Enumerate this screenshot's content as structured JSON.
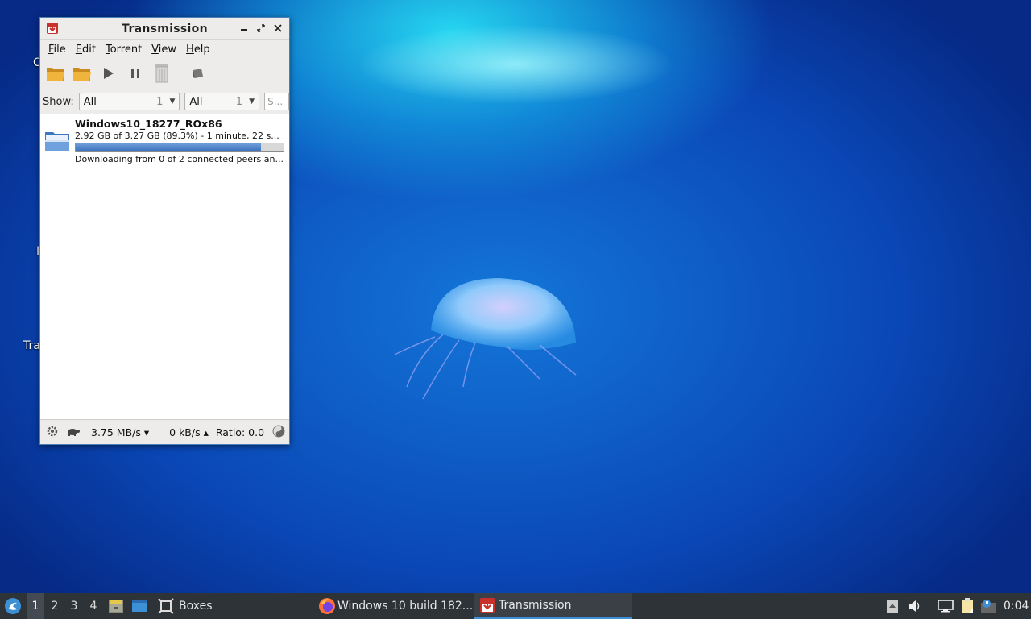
{
  "desktop": {
    "fragment_1": "C",
    "fragment_2": "I",
    "fragment_3": "Tra"
  },
  "window": {
    "title": "Transmission",
    "menu": [
      "File",
      "Edit",
      "Torrent",
      "View",
      "Help"
    ],
    "filter": {
      "show_label": "Show:",
      "filter1_value": "All",
      "filter1_count": "1",
      "filter2_value": "All",
      "filter2_count": "1",
      "search_placeholder": "S..."
    },
    "torrent": {
      "name": "Windows10_18277_ROx86",
      "progress_text": "2.92 GB of 3.27 GB (89.3%) - 1 minute, 22 s...",
      "progress_fraction": 0.893,
      "status_text": "Downloading from 0 of 2 connected peers an..."
    },
    "statusbar": {
      "download_speed": "3.75 MB/s ▾",
      "upload_speed": "0 kB/s ▴",
      "ratio": "Ratio: 0.0"
    }
  },
  "taskbar": {
    "workspaces": [
      "1",
      "2",
      "3",
      "4"
    ],
    "active_workspace": "1",
    "boxes_label": "Boxes",
    "firefox_label": "Windows 10 build 182...",
    "transmission_label": "Transmission",
    "clock": "0:04"
  },
  "colors": {
    "accent": "#3d8fd6",
    "progress_fill": "#4a80c6",
    "taskbar_bg": "#2e3338"
  }
}
